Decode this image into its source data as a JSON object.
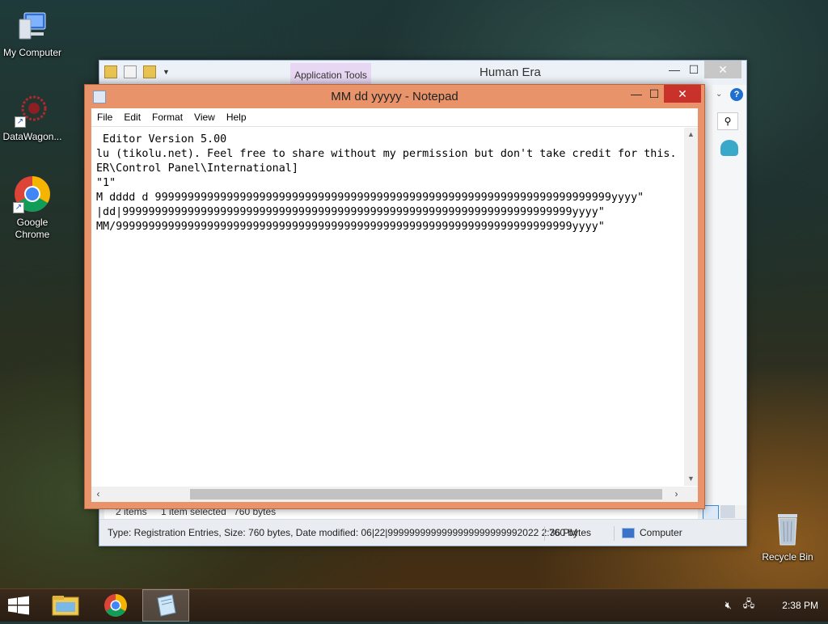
{
  "desktop": {
    "icons": [
      {
        "label": "My Computer"
      },
      {
        "label": "DataWagon..."
      },
      {
        "label": "Google Chrome"
      },
      {
        "label": "Recycle Bin"
      }
    ]
  },
  "explorer": {
    "contextual_tab": "Application Tools",
    "title": "Human Era",
    "status": {
      "items": "2 items",
      "selected": "1 item selected",
      "size": "760 bytes"
    },
    "details": {
      "type_line": "Type: Registration Entries, Size: 760 bytes, Date modified: 06|22|9999999999999999999999992022 2:36 PM",
      "size": "760 bytes",
      "location": "Computer"
    }
  },
  "notepad": {
    "title": "MM dd yyyyy - Notepad",
    "menu": [
      "File",
      "Edit",
      "Format",
      "View",
      "Help"
    ],
    "lines": [
      " Editor Version 5.00",
      "",
      "lu (tikolu.net). Feel free to share without my permission but don't take credit for this.",
      "ER\\Control Panel\\International]",
      "\"1\"",
      "M dddd d 9999999999999999999999999999999999999999999999999999999999999999999999yyyy\"",
      "|dd|999999999999999999999999999999999999999999999999999999999999999999999yyyy\"",
      "MM/9999999999999999999999999999999999999999999999999999999999999999999999yyyy\""
    ]
  },
  "taskbar": {
    "clock": "2:38 PM"
  },
  "colors": {
    "notepad_frame": "#e8936a",
    "close_red": "#c8322a",
    "app_tools_tab": "#e7d7f2",
    "taskbar": "#2a1d12"
  }
}
